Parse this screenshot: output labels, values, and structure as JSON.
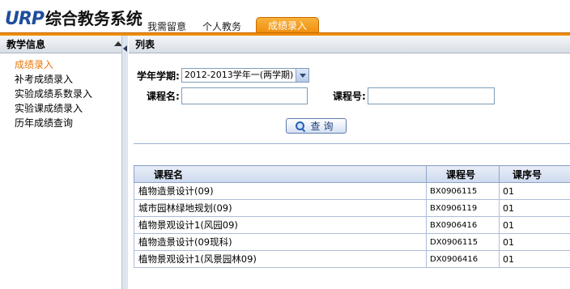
{
  "app": {
    "logo_brand": "URP",
    "logo_title": "综合教务系统"
  },
  "header": {
    "tabs": [
      {
        "label": "我需留意"
      },
      {
        "label": "个人教务"
      },
      {
        "label": "成绩录入",
        "active": true
      }
    ],
    "accent_color": "#ef8b0c"
  },
  "sidebar": {
    "title": "教学信息",
    "items": [
      {
        "label": "成绩录入",
        "active": true
      },
      {
        "label": "补考成绩录入"
      },
      {
        "label": "实验成绩系数录入"
      },
      {
        "label": "实验课成绩录入"
      },
      {
        "label": "历年成绩查询"
      }
    ]
  },
  "main": {
    "section_title": "列表",
    "term_label": "学年学期:",
    "term_value": "2012-2013学年一(两学期)",
    "course_name_label": "课程名:",
    "course_name_value": "",
    "course_code_label": "课程号:",
    "course_code_value": "",
    "search_button": "查询",
    "table": {
      "columns": [
        "课程名",
        "课程号",
        "课序号"
      ],
      "rows": [
        {
          "name": "植物造景设计(09)",
          "code": "BX0906115",
          "seq": "01"
        },
        {
          "name": "城市园林绿地规划(09)",
          "code": "BX0906119",
          "seq": "01"
        },
        {
          "name": "植物景观设计1(风园09)",
          "code": "BX0906416",
          "seq": "01"
        },
        {
          "name": "植物造景设计(09现科)",
          "code": "DX0906115",
          "seq": "01"
        },
        {
          "name": "植物景观设计1(风景园林09)",
          "code": "DX0906416",
          "seq": "01"
        }
      ]
    }
  }
}
